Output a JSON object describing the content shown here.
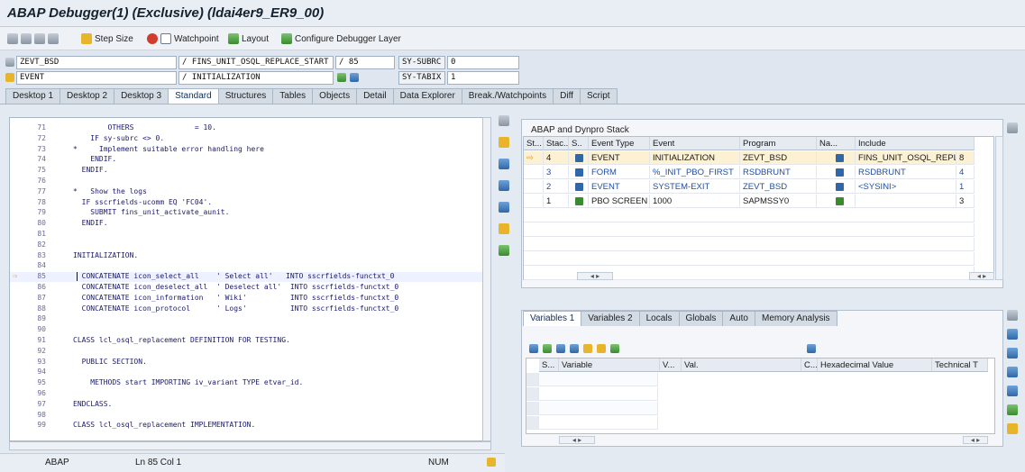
{
  "window": {
    "title": "ABAP Debugger(1)  (Exclusive) (ldai4er9_ER9_00)"
  },
  "toolbar": {
    "step_size": "Step Size",
    "watchpoint": "Watchpoint",
    "layout": "Layout",
    "configure": "Configure Debugger Layer"
  },
  "header": {
    "program": "ZEVT_BSD",
    "include": "/ FINS_UNIT_OSQL_REPLACE_START",
    "line": "/ 85",
    "sy_subrc_label": "SY-SUBRC",
    "sy_subrc_value": "0",
    "event_type": "EVENT",
    "event": "/ INITIALIZATION",
    "sy_tabix_label": "SY-TABIX",
    "sy_tabix_value": "1"
  },
  "tabs": [
    "Desktop 1",
    "Desktop 2",
    "Desktop 3",
    "Standard",
    "Structures",
    "Tables",
    "Objects",
    "Detail",
    "Data Explorer",
    "Break./Watchpoints",
    "Diff",
    "Script"
  ],
  "active_tab": "Standard",
  "code": [
    {
      "n": "71",
      "t": "        OTHERS              = 10."
    },
    {
      "n": "72",
      "t": "    IF sy-subrc <> 0."
    },
    {
      "n": "73",
      "t": "*     Implement suitable error handling here"
    },
    {
      "n": "74",
      "t": "    ENDIF."
    },
    {
      "n": "75",
      "t": "  ENDIF."
    },
    {
      "n": "76",
      "t": ""
    },
    {
      "n": "77",
      "t": "*   Show the logs"
    },
    {
      "n": "78",
      "t": "  IF sscrfields-ucomm EQ 'FC04'."
    },
    {
      "n": "79",
      "t": "    SUBMIT fins_unit_activate_aunit."
    },
    {
      "n": "80",
      "t": "  ENDIF."
    },
    {
      "n": "81",
      "t": ""
    },
    {
      "n": "82",
      "t": ""
    },
    {
      "n": "83",
      "t": "INITIALIZATION."
    },
    {
      "n": "84",
      "t": ""
    },
    {
      "n": "85",
      "t": "  CONCATENATE icon_select_all    ' Select all'   INTO sscrfields-functxt_0"
    },
    {
      "n": "86",
      "t": "  CONCATENATE icon_deselect_all  ' Deselect all'  INTO sscrfields-functxt_0"
    },
    {
      "n": "87",
      "t": "  CONCATENATE icon_information   ' Wiki'          INTO sscrfields-functxt_0"
    },
    {
      "n": "88",
      "t": "  CONCATENATE icon_protocol      ' Logs'          INTO sscrfields-functxt_0"
    },
    {
      "n": "89",
      "t": ""
    },
    {
      "n": "90",
      "t": ""
    },
    {
      "n": "91",
      "t": "CLASS lcl_osql_replacement DEFINITION FOR TESTING."
    },
    {
      "n": "92",
      "t": ""
    },
    {
      "n": "93",
      "t": "  PUBLIC SECTION."
    },
    {
      "n": "94",
      "t": ""
    },
    {
      "n": "95",
      "t": "    METHODS start IMPORTING iv_variant TYPE etvar_id."
    },
    {
      "n": "96",
      "t": ""
    },
    {
      "n": "97",
      "t": "ENDCLASS."
    },
    {
      "n": "98",
      "t": ""
    },
    {
      "n": "99",
      "t": "CLASS lcl_osql_replacement IMPLEMENTATION."
    }
  ],
  "status": {
    "lang": "ABAP",
    "position": "Ln 85 Col  1",
    "num": "NUM"
  },
  "stack_panel": {
    "title": "ABAP and Dynpro Stack",
    "columns": [
      "St...",
      "Stac...",
      "S..",
      "Event Type",
      "Event",
      "Program",
      "Na...",
      "Include"
    ],
    "rows": [
      {
        "stack": "4",
        "etype": "EVENT",
        "event": "INITIALIZATION",
        "program": "ZEVT_BSD",
        "include": "FINS_UNIT_OSQL_REPL..",
        "line": "8"
      },
      {
        "stack": "3",
        "etype": "FORM",
        "event": "%_INIT_PBO_FIRST",
        "program": "RSDBRUNT",
        "include": "RSDBRUNT",
        "line": "4"
      },
      {
        "stack": "2",
        "etype": "EVENT",
        "event": "SYSTEM-EXIT",
        "program": "ZEVT_BSD",
        "include": "<SYSINI>",
        "line": "1"
      },
      {
        "stack": "1",
        "etype": "PBO SCREEN",
        "event": "1000",
        "program": "SAPMSSY0",
        "include": "",
        "line": "3"
      }
    ]
  },
  "var_tabs": [
    "Variables 1",
    "Variables 2",
    "Locals",
    "Globals",
    "Auto",
    "Memory Analysis"
  ],
  "var_columns": [
    "S...",
    "Variable",
    "V...",
    "Val.",
    "C...",
    "Hexadecimal Value",
    "Technical T"
  ],
  "colors": {
    "accent": "#1f4fa6",
    "selected_row": "#fdf1d4"
  }
}
